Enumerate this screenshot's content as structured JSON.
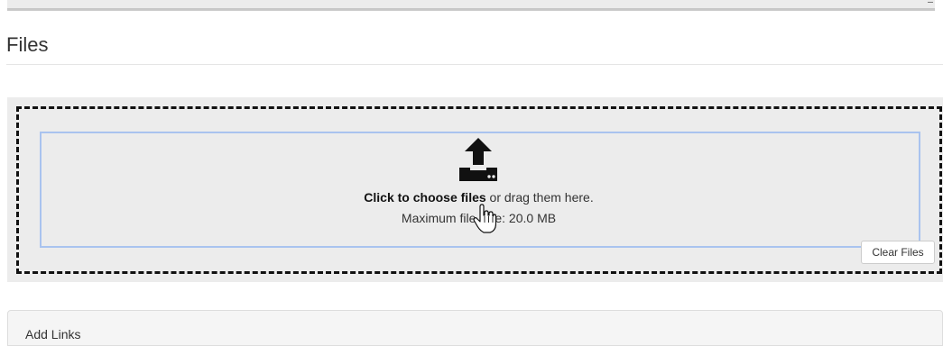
{
  "section": {
    "title": "Files"
  },
  "dropzone": {
    "choose_bold": "Click to choose files",
    "choose_rest": " or drag them here.",
    "max_size": "Maximum file size: 20.0 MB",
    "icon": "upload-icon"
  },
  "buttons": {
    "clear_files": "Clear Files"
  },
  "panels": {
    "add_links": "Add Links"
  },
  "colors": {
    "dropzone_bg": "#ececec",
    "inner_border": "#a9c3ef",
    "dashed_border": "#111111"
  }
}
